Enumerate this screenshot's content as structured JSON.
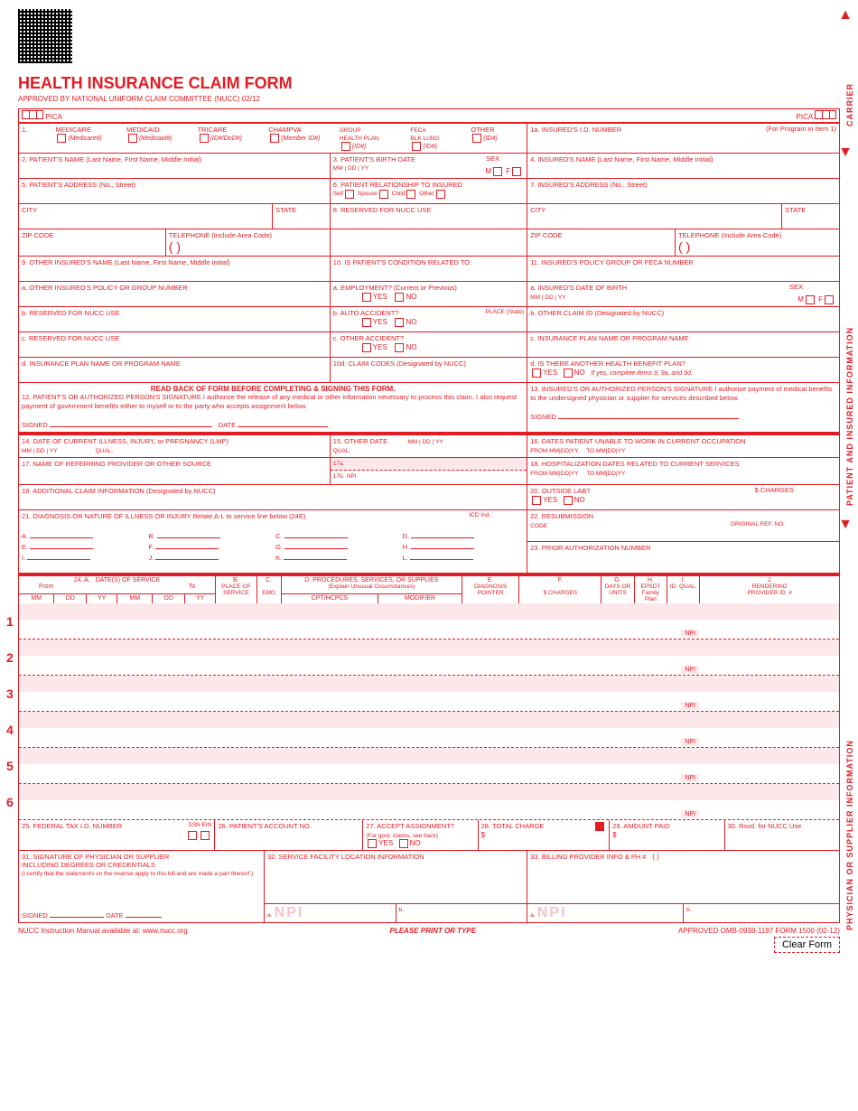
{
  "title": "HEALTH INSURANCE CLAIM FORM",
  "approved": "APPROVED BY NATIONAL UNIFORM CLAIM COMMITTEE (NUCC) 02/12",
  "pica": "PICA",
  "vtext": {
    "carrier": "CARRIER",
    "patient": "PATIENT AND INSURED INFORMATION",
    "physician": "PHYSICIAN OR SUPPLIER INFORMATION"
  },
  "box1": {
    "num": "1.",
    "medicare": "MEDICARE",
    "medicare_sub": "(Medicare#)",
    "medicaid": "MEDICAID",
    "medicaid_sub": "(Medicaid#)",
    "tricare": "TRICARE",
    "tricare_sub": "(ID#/DoD#)",
    "champva": "CHAMPVA",
    "champva_sub": "(Member ID#)",
    "group": "GROUP\nHEALTH PLAN",
    "group_sub": "(ID#)",
    "feca": "FECA\nBLK LUNG",
    "feca_sub": "(ID#)",
    "other": "OTHER",
    "other_sub": "(ID#)"
  },
  "box1a": {
    "label": "1a. INSURED'S I.D. NUMBER",
    "sub": "(For Program in Item 1)"
  },
  "box2": "2. PATIENT'S NAME (Last Name, First Name, Middle Initial)",
  "box3": {
    "label": "3. PATIENT'S BIRTH DATE",
    "mm": "MM",
    "dd": "DD",
    "yy": "YY",
    "sex": "SEX",
    "m": "M",
    "f": "F"
  },
  "box4": "4. INSURED'S NAME (Last Name, First Name, Middle Initial)",
  "box5": "5. PATIENT'S ADDRESS (No., Street)",
  "box6": {
    "label": "6. PATIENT RELATIONSHIP TO INSURED",
    "self": "Self",
    "spouse": "Spouse",
    "child": "Child",
    "other": "Other"
  },
  "box7": "7. INSURED'S ADDRESS (No., Street)",
  "city": "CITY",
  "state": "STATE",
  "zip": "ZIP CODE",
  "phone": "TELEPHONE (Include Area Code)",
  "box8": "8. RESERVED FOR NUCC USE",
  "box9": "9. OTHER INSURED'S NAME (Last Name, First Name, Middle Initial)",
  "box9a": "a. OTHER INSURED'S POLICY OR GROUP NUMBER",
  "box9b": "b. RESERVED FOR NUCC USE",
  "box9c": "c. RESERVED FOR NUCC USE",
  "box9d": "d. INSURANCE PLAN NAME OR PROGRAM NAME",
  "box10": {
    "label": "10. IS PATIENT'S CONDITION RELATED TO:",
    "a": "a. EMPLOYMENT? (Current or Previous)",
    "b": "b. AUTO ACCIDENT?",
    "place": "PLACE (State)",
    "c": "c. OTHER ACCIDENT?",
    "yes": "YES",
    "no": "NO"
  },
  "box10d": "10d. CLAIM CODES (Designated by NUCC)",
  "box11": "11. INSURED'S POLICY GROUP OR FECA NUMBER",
  "box11a": {
    "label": "a. INSURED'S DATE OF BIRTH",
    "sex": "SEX"
  },
  "box11b": "b. OTHER CLAIM ID (Designated by NUCC)",
  "box11c": "c. INSURANCE PLAN NAME OR PROGRAM NAME",
  "box11d": {
    "label": "d. IS THERE ANOTHER HEALTH BENEFIT PLAN?",
    "note": "If yes, complete items 9, 9a, and 9d."
  },
  "readback": "READ BACK OF FORM BEFORE COMPLETING & SIGNING THIS FORM.",
  "box12": "12. PATIENT'S OR AUTHORIZED PERSON'S SIGNATURE  I authorize the release of any medical or other information necessary to process this claim. I also request payment of government benefits either to myself or to the party who accepts assignment below.",
  "box13": "13. INSURED'S OR AUTHORIZED PERSON'S SIGNATURE I authorize payment of medical benefits to the undersigned physician or supplier for services described below.",
  "signed": "SIGNED",
  "date": "DATE",
  "box14": {
    "label": "14. DATE OF CURRENT ILLNESS, INJURY, or PREGNANCY (LMP)",
    "qual": "QUAL."
  },
  "box15": {
    "label": "15. OTHER DATE",
    "qual": "QUAL."
  },
  "box16": {
    "label": "16. DATES PATIENT UNABLE TO WORK IN CURRENT OCCUPATION",
    "from": "FROM",
    "to": "TO"
  },
  "box17": "17. NAME OF REFERRING PROVIDER OR OTHER SOURCE",
  "box17a": "17a.",
  "box17b": "17b.",
  "npi": "NPI",
  "box18": {
    "label": "18. HOSPITALIZATION DATES RELATED TO CURRENT SERVICES",
    "from": "FROM",
    "to": "TO"
  },
  "box19": "19. ADDITIONAL CLAIM INFORMATION (Designated by NUCC)",
  "box20": {
    "label": "20. OUTSIDE LAB?",
    "charges": "$ CHARGES"
  },
  "box21": {
    "label": "21. DIAGNOSIS OR NATURE OF ILLNESS OR INJURY  Relate A-L to service line below (24E)",
    "icd": "ICD Ind."
  },
  "diag_letters": [
    "A.",
    "B.",
    "C.",
    "D.",
    "E.",
    "F.",
    "G.",
    "H.",
    "I.",
    "J.",
    "K.",
    "L."
  ],
  "box22": {
    "label": "22. RESUBMISSION",
    "code": "CODE",
    "orig": "ORIGINAL REF. NO."
  },
  "box23": "23. PRIOR AUTHORIZATION NUMBER",
  "box24": {
    "a": "24. A.",
    "dates": "DATE(S) OF SERVICE",
    "from": "From",
    "to": "To",
    "mm": "MM",
    "dd": "DD",
    "yy": "YY",
    "b": "B.",
    "place": "PLACE OF",
    "service": "SERVICE",
    "c": "C.",
    "emg": "EMG",
    "d": "D. PROCEDURES, SERVICES, OR SUPPLIES",
    "explain": "(Explain Unusual Circumstances)",
    "cpt": "CPT/HCPCS",
    "mod": "MODIFIER",
    "e": "E.",
    "diag": "DIAGNOSIS",
    "pointer": "POINTER",
    "f": "F.",
    "charges": "$ CHARGES",
    "g": "G.",
    "days": "DAYS OR UNITS",
    "h": "H.",
    "epsdt": "EPSDT Family Plan",
    "i": "I.",
    "idqual": "ID. QUAL.",
    "j": "J.",
    "rendering": "RENDERING",
    "provid": "PROVIDER ID. #"
  },
  "line_npi": "NPI",
  "box25": {
    "label": "25. FEDERAL TAX I.D. NUMBER",
    "ssn": "SSN",
    "ein": "EIN"
  },
  "box26": "26. PATIENT'S ACCOUNT NO.",
  "box27": {
    "label": "27. ACCEPT ASSIGNMENT?",
    "sub": "(For govt. claims, see back)"
  },
  "box28": "28. TOTAL CHARGE",
  "box29": "29. AMOUNT PAID",
  "box30": "30. Rsvd. for NUCC Use",
  "dollar": "$",
  "box31": {
    "label": "31. SIGNATURE OF PHYSICIAN OR SUPPLIER",
    "sub": "INCLUDING DEGREES OR CREDENTIALS",
    "cert": "(I certify that the statements on the reverse apply to this bill and are made a part thereof.)"
  },
  "box32": "32. SERVICE FACILITY LOCATION INFORMATION",
  "box33": "33. BILLING PROVIDER INFO & PH #",
  "ab": {
    "a": "a.",
    "b": "b."
  },
  "footer": {
    "left": "NUCC Instruction Manual available at: www.nucc.org",
    "center": "PLEASE PRINT OR TYPE",
    "right": "APPROVED OMB-0938-1197 FORM 1500 (02-12)"
  },
  "clear": "Clear Form",
  "yes": "YES",
  "no": "NO",
  "paren": "(          )"
}
